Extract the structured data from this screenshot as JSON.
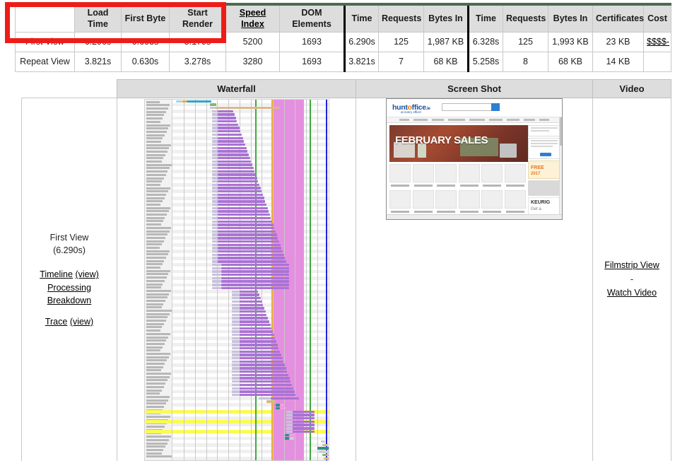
{
  "summary_table": {
    "row_header_label": "",
    "headers": [
      "Load Time",
      "First Byte",
      "Start Render",
      "Speed Index",
      "DOM Elements",
      "Time",
      "Requests",
      "Bytes In",
      "Time",
      "Requests",
      "Bytes In",
      "Certificates",
      "Cost"
    ],
    "underlined_headers": [
      "Speed Index"
    ],
    "rows": [
      {
        "label": "First View",
        "load_time": "6.290s",
        "first_byte": "0.603s",
        "start_render": "5.179s",
        "speed_index": "5200",
        "dom_elements": "1693",
        "doc_time": "6.290s",
        "doc_requests": "125",
        "doc_bytes_in": "1,987 KB",
        "full_time": "6.328s",
        "full_requests": "125",
        "full_bytes_in": "1,993 KB",
        "certificates": "23 KB",
        "cost": "$$$$-"
      },
      {
        "label": "Repeat View",
        "load_time": "3.821s",
        "first_byte": "0.630s",
        "start_render": "3.278s",
        "speed_index": "3280",
        "dom_elements": "1693",
        "doc_time": "3.821s",
        "doc_requests": "7",
        "doc_bytes_in": "68 KB",
        "full_time": "5.258s",
        "full_requests": "8",
        "full_bytes_in": "68 KB",
        "certificates": "14 KB",
        "cost": ""
      }
    ]
  },
  "annotation": {
    "type": "red-rectangle-highlight",
    "color": "#ee1c18",
    "covers": "First View row: Load Time, First Byte, Start Render"
  },
  "detail_table": {
    "headers": {
      "blank": "",
      "waterfall": "Waterfall",
      "screenshot": "Screen Shot",
      "video": "Video"
    },
    "view_cell": {
      "title": "First View",
      "time": "(6.290s)",
      "timeline_link": "Timeline",
      "timeline_view": "(view)",
      "processing_breakdown_link": "Processing Breakdown",
      "trace_link": "Trace",
      "trace_view": "(view)"
    },
    "video_cell": {
      "filmstrip_link": "Filmstrip View",
      "separator": "-",
      "watch_video_link": "Watch Video"
    }
  },
  "screenshot_thumb": {
    "site_logo_a": "hunt",
    "site_logo_b": "o",
    "site_logo_c": "ffice",
    "site_logo_tld": ".ie",
    "site_tagline": "at every office!",
    "hero_headline": "FEBRUARY SALES",
    "promo_free": "FREE",
    "promo_year": "2017",
    "brand_keurig": "KEURIG",
    "brand_keurig_sub": "Get a"
  },
  "waterfall": {
    "row_count": 108,
    "highlighted_rows": [
      93,
      96,
      99
    ],
    "markers": [
      {
        "name": "start-render-green",
        "color": "#3faa3f",
        "pos_pct": 53.0
      },
      {
        "name": "dom-content-loaded-orange",
        "color": "#f0a830",
        "pos_pct": 63.5
      },
      {
        "name": "on-load-green",
        "color": "#3faa3f",
        "pos_pct": 88.0
      },
      {
        "name": "fully-loaded-blue",
        "color": "#2222dd",
        "pos_pct": 98.5
      }
    ],
    "render_band": {
      "name": "start-render-band",
      "color": "#e58fe0",
      "from_pct": 64.5,
      "to_pct": 84.5
    },
    "gridline_count": 13
  },
  "colors": {
    "table_header_bg": "#dddddd",
    "table_top_border": "#4b6b4f",
    "annotation_red": "#ee1c18",
    "waterfall_download": "#a973d4",
    "waterfall_wait": "#c9c1dd",
    "waterfall_band": "#e58fe0",
    "waterfall_highlight": "#fbfb52"
  }
}
